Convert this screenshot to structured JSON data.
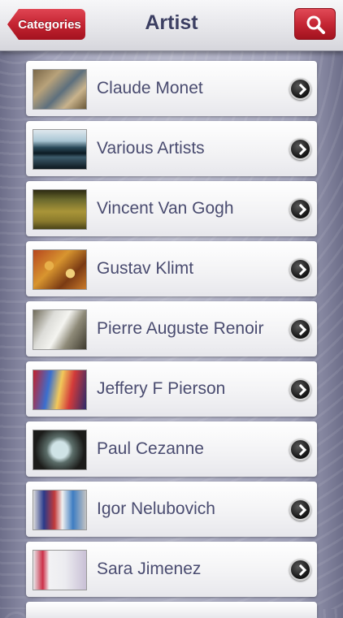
{
  "navbar": {
    "back_label": "Categories",
    "title": "Artist",
    "search_icon": "magnifier-icon"
  },
  "colors": {
    "nav_button_red": "#c42432",
    "title_text": "#3c3f62",
    "row_text": "#4a4c70"
  },
  "artists": [
    {
      "name": "Claude Monet"
    },
    {
      "name": "Various Artists"
    },
    {
      "name": "Vincent Van Gogh"
    },
    {
      "name": "Gustav Klimt"
    },
    {
      "name": "Pierre Auguste Renoir"
    },
    {
      "name": "Jeffery F Pierson"
    },
    {
      "name": "Paul Cezanne"
    },
    {
      "name": "Igor Nelubovich"
    },
    {
      "name": "Sara Jimenez"
    }
  ]
}
